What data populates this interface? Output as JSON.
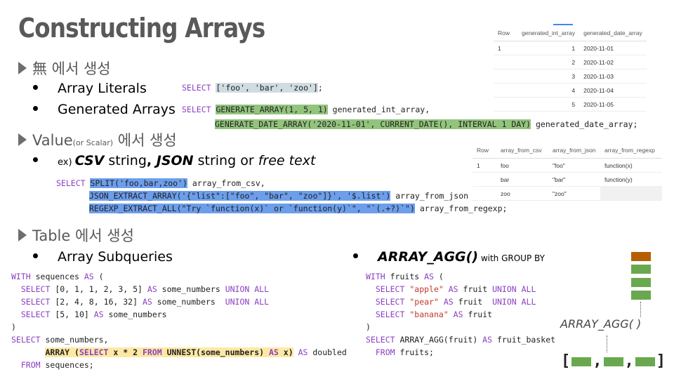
{
  "title": "Constructing Arrays",
  "sections": {
    "s1": "無 에서 생성",
    "s2_main": "Value",
    "s2_small": "(or Scalar)",
    "s2_tail": " 에서 생성",
    "s3": "Table 에서 생성"
  },
  "bullets": {
    "literals": "Array Literals",
    "generated": "Generated Arrays",
    "ex_prefix": "ex) ",
    "csv": "CSV",
    "string1": " string",
    "comma": ", ",
    "json": "JSON",
    "string2": " string or ",
    "free": "free text",
    "subq": "Array Subqueries",
    "agg": "ARRAY_AGG()",
    "agg_suffix": " with GROUP BY"
  },
  "code": {
    "lit": {
      "kw": "SELECT ",
      "arr": "['foo', 'bar', 'zoo']",
      "end": ";"
    },
    "gen1": {
      "kw": "SELECT ",
      "fn": "GENERATE_ARRAY(1, 5, 1)",
      "tail": " generated_int_array,"
    },
    "gen2": {
      "fn": "GENERATE_DATE_ARRAY('2020-11-01', CURRENT_DATE(), INTERVAL 1 DAY)",
      "tail": " generated_date_array;"
    },
    "csv1": {
      "kw": "SELECT ",
      "fn": "SPLIT('foo,bar,zoo')",
      "tail": " array_from_csv,"
    },
    "csv2": {
      "fn": "JSON_EXTRACT_ARRAY('{\"list\":[\"foo\", \"bar\", \"zoo\"]}', '$.list')",
      "tail": " array_from_json"
    },
    "csv3": {
      "fn": "REGEXP_EXTRACT_ALL(\"Try `function(x)` or `function(y)`\", \"`(.+?)`\")",
      "tail": " array_from_regexp;"
    },
    "sub": [
      "WITH sequences AS (",
      "  SELECT [0, 1, 1, 2, 3, 5] AS some_numbers UNION ALL",
      "  SELECT [2, 4, 8, 16, 32] AS some_numbers  UNION ALL",
      "  SELECT [5, 10] AS some_numbers",
      ")",
      "SELECT some_numbers,",
      "ARRAY (SELECT x * 2 FROM UNNEST(some_numbers) AS x)",
      " AS doubled",
      "  FROM sequences;"
    ],
    "agg": [
      "WITH fruits AS (",
      "  SELECT \"apple\" AS fruit UNION ALL",
      "  SELECT \"pear\" AS fruit  UNION ALL",
      "  SELECT \"banana\" AS fruit",
      ")",
      "SELECT ARRAY_AGG(fruit) AS fruit_basket",
      "  FROM fruits;"
    ]
  },
  "table1": {
    "headers": [
      "Row",
      "generated_int_array",
      "generated_date_array"
    ],
    "row": "1",
    "ints": [
      "1",
      "2",
      "3",
      "4",
      "5"
    ],
    "dates": [
      "2020-11-01",
      "2020-11-02",
      "2020-11-03",
      "2020-11-04",
      "2020-11-05"
    ]
  },
  "table2": {
    "headers": [
      "Row",
      "array_from_csv",
      "array_from_json",
      "array_from_regexp"
    ],
    "row": "1",
    "csv": [
      "foo",
      "bar",
      "zoo"
    ],
    "json": [
      "\"foo\"",
      "\"bar\"",
      "\"zoo\""
    ],
    "regexp": [
      "function(x)",
      "function(y)",
      ""
    ]
  },
  "diagram": {
    "label": "ARRAY_AGG(   )",
    "open_bracket": "[",
    "close_bracket": "]",
    "sep": ",",
    "top_color": "#b45f06",
    "item_color": "#6aa84f"
  }
}
